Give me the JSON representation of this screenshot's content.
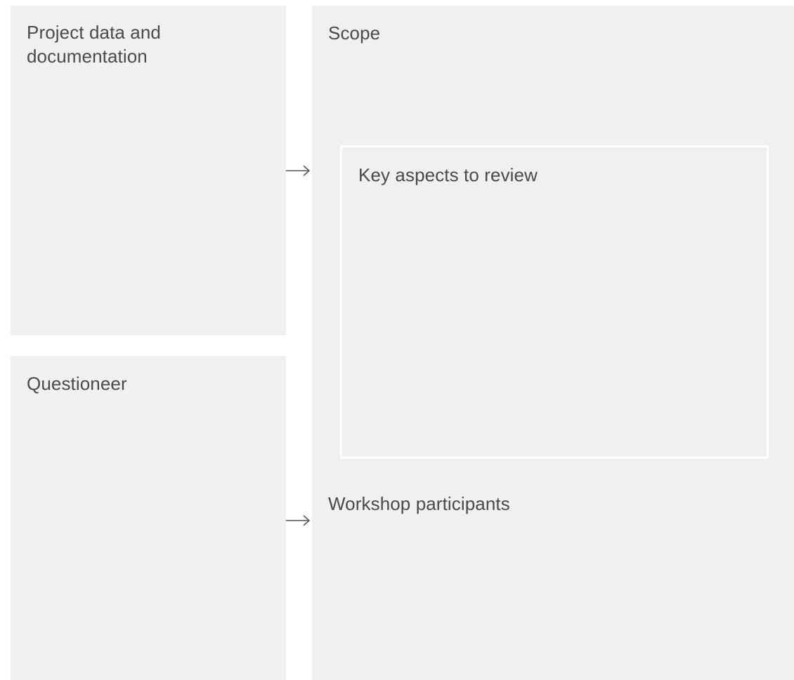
{
  "panels": {
    "project_data": {
      "title": "Project data and documentation"
    },
    "questioneer": {
      "title": "Questioneer"
    },
    "scope": {
      "title": "Scope",
      "key_aspects": {
        "title": "Key aspects to review"
      },
      "workshop": {
        "title": "Workshop participants"
      }
    }
  },
  "arrows": [
    {
      "icon": "arrow-right-icon"
    },
    {
      "icon": "arrow-right-icon"
    }
  ],
  "colors": {
    "panel_background": "#f0f0f0",
    "text": "#4a4a4a",
    "inner_border": "#ffffff",
    "arrow": "#555555"
  }
}
